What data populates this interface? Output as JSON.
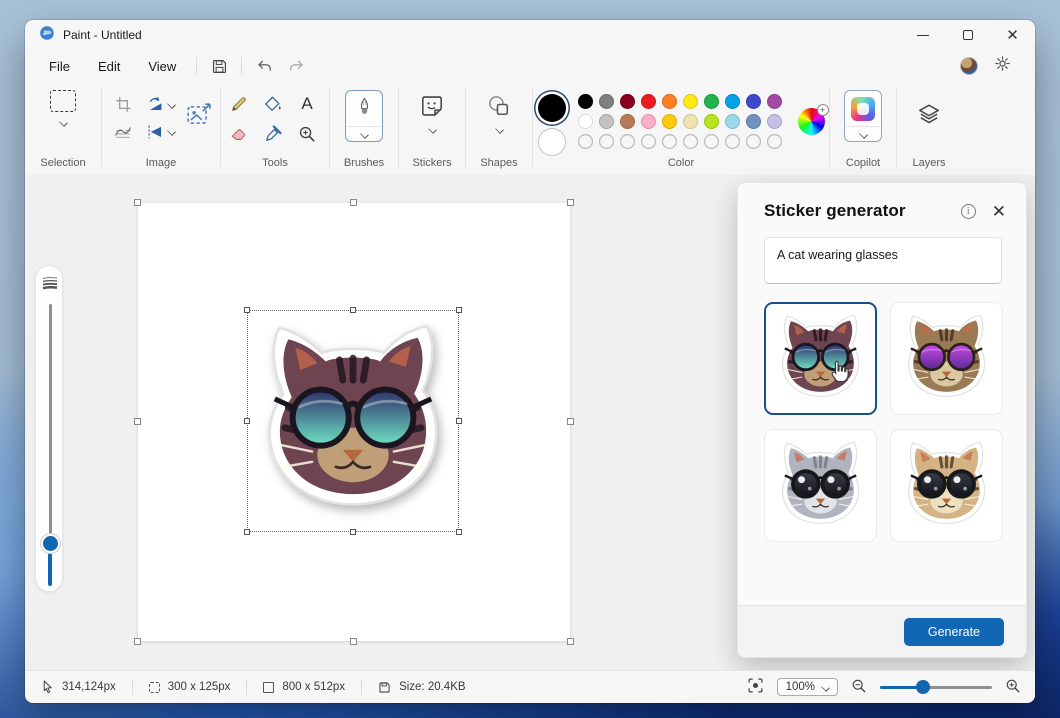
{
  "window": {
    "title": "Paint - Untitled"
  },
  "menu": {
    "items": [
      "File",
      "Edit",
      "View"
    ]
  },
  "toolbar": {
    "groups": [
      {
        "label": "Selection"
      },
      {
        "label": "Image"
      },
      {
        "label": "Tools"
      },
      {
        "label": "Brushes"
      },
      {
        "label": "Stickers"
      },
      {
        "label": "Shapes"
      },
      {
        "label": "Color"
      },
      {
        "label": "Copilot"
      },
      {
        "label": "Layers"
      }
    ],
    "text_tool_glyph": "A",
    "color1": "#000000",
    "color2": "#ffffff",
    "palette": {
      "row1": [
        "#000000",
        "#7f7f7f",
        "#88001b",
        "#ec1c24",
        "#ff7f27",
        "#ffe913",
        "#22b14c",
        "#00a2e8",
        "#3f48cc",
        "#a349a4"
      ],
      "row2": [
        "#ffffff",
        "#c3c3c3",
        "#b97a57",
        "#ffaec9",
        "#ffc90e",
        "#efe4b0",
        "#b5e61d",
        "#99d9ea",
        "#7092be",
        "#c8bfe7"
      ],
      "empty_slots": 10
    }
  },
  "sticker_panel": {
    "title": "Sticker generator",
    "prompt": "A cat wearing glasses",
    "generate_label": "Generate",
    "selected_index": 0,
    "stickers": [
      {
        "alt": "tabby-cat-teal-round-glasses",
        "fur1": "#6e4450",
        "fur2": "#c9a87c",
        "stripe": "#241722",
        "lens1": "#2c2f6b",
        "lens2": "#6fe3c2",
        "rim": "#1b1520",
        "style": "round"
      },
      {
        "alt": "brown-tabby-purple-sunglasses",
        "fur1": "#9a7a54",
        "fur2": "#e0d0a8",
        "stripe": "#4a3420",
        "lens1": "#c84ae8",
        "lens2": "#5a2a92",
        "rim": "#2a2018",
        "style": "round"
      },
      {
        "alt": "gray-cat-black-round-glasses",
        "fur1": "#b0b4bf",
        "fur2": "#e6e8ec",
        "stripe": "#787c88",
        "lens1": "#3a3f4a",
        "lens2": "#12141a",
        "rim": "#17181c",
        "style": "shiny"
      },
      {
        "alt": "tabby-kitten-big-round-glasses",
        "fur1": "#d3b383",
        "fur2": "#f0e4c6",
        "stripe": "#54402a",
        "lens1": "#3a3f4a",
        "lens2": "#101216",
        "rim": "#17181c",
        "style": "shiny"
      }
    ]
  },
  "status_bar": {
    "cursor_position": "314,124px",
    "selection_size": "300 x 125px",
    "canvas_size": "800 x 512px",
    "file_size": "Size: 20.4KB",
    "zoom": "100%"
  },
  "colors": {
    "accent": "#1267b4",
    "selected_card_border": "#1a4f8c",
    "slider_blue": "#1266b1"
  }
}
